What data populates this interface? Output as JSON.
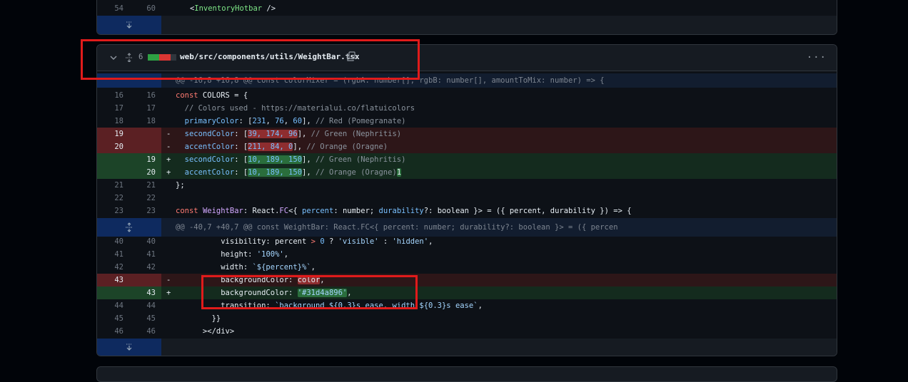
{
  "colors": {
    "red_box": "#e01b1b",
    "expander": "#0e2a5f",
    "deleted_row": "#2d1618",
    "added_row": "#142b1e"
  },
  "top_section": {
    "line": {
      "old": "54",
      "new": "60",
      "prefix": "<",
      "tag": "InventoryHotbar",
      "suffix": " />"
    }
  },
  "file_header": {
    "changes_count": "6",
    "diffstat_blocks": [
      "green",
      "green",
      "red",
      "red",
      "gray"
    ],
    "path": "web/src/components/utils/WeightBar.tsx",
    "icons": [
      "chevron-down-icon",
      "expand-lines-icon",
      "copy-icon",
      "more-options-icon"
    ]
  },
  "hunk1": "@@ -16,8 +16,8 @@ const colorMixer = (rgbA: number[], rgbB: number[], amountToMix: number) => {",
  "hunk2": "@@ -40,7 +40,7 @@ const WeightBar: React.FC<{ percent: number; durability?: boolean }> = ({ percen",
  "lines": {
    "l16": {
      "old": "16",
      "new": "16",
      "a": "const",
      "b": " COLORS = {"
    },
    "l17": {
      "old": "17",
      "new": "17",
      "text": "  // Colors used - https://materialui.co/flatuicolors"
    },
    "l18": {
      "old": "18",
      "new": "18",
      "key": "  primaryColor",
      "p1": ": [",
      "n1": "231",
      "c1": ", ",
      "n2": "76",
      "c2": ", ",
      "n3": "60",
      "end": "], ",
      "comment": "// Red (Pomegranate)"
    },
    "d19": {
      "old": "19",
      "sign": "-",
      "key": "  secondColor",
      "p1": ": [",
      "hl": "39, 174, 96",
      "end": "], ",
      "comment": "// Green (Nephritis)"
    },
    "d20": {
      "old": "20",
      "sign": "-",
      "key": "  accentColor",
      "p1": ": [",
      "hl": "211, 84, 0",
      "end": "], ",
      "comment": "// Orange (Oragne)"
    },
    "a19": {
      "new": "19",
      "sign": "+",
      "key": "  secondColor",
      "p1": ": [",
      "hl": "10, 189, 150",
      "end": "], ",
      "comment": "// Green (Nephritis)"
    },
    "a20": {
      "new": "20",
      "sign": "+",
      "key": "  accentColor",
      "p1": ": [",
      "hl": "10, 189, 150",
      "end": "], ",
      "comment": "// Orange (Oragne)",
      "extra": "1"
    },
    "l21": {
      "old": "21",
      "new": "21",
      "text": "};"
    },
    "l22": {
      "old": "22",
      "new": "22",
      "text": ""
    },
    "l23": {
      "old": "23",
      "new": "23",
      "a": "const",
      "b": " ",
      "fn": "WeightBar",
      "c": ": React.",
      "fc": "FC",
      "d": "<{ ",
      "p": "percent",
      "e": ": number; ",
      "du": "durability",
      "f": "?: boolean }> = ({ percent, durability }) => {"
    },
    "l40": {
      "old": "40",
      "new": "40",
      "a": "          visibility: percent ",
      "op": ">",
      "b": " ",
      "n": "0",
      "c": " ? ",
      "s1": "'visible'",
      "d": " : ",
      "s2": "'hidden'",
      "e": ","
    },
    "l41": {
      "old": "41",
      "new": "41",
      "a": "          height: ",
      "s": "'100%'",
      "e": ","
    },
    "l42": {
      "old": "42",
      "new": "42",
      "a": "          width: ",
      "s": "`${percent}%`",
      "e": ","
    },
    "d43": {
      "old": "43",
      "sign": "-",
      "a": "          backgroundColor: ",
      "hl": "color",
      "e": ","
    },
    "a43": {
      "new": "43",
      "sign": "+",
      "a": "          backgroundColor: ",
      "hl": "'#31d4a896'",
      "e": ","
    },
    "l44": {
      "old": "44",
      "new": "44",
      "a": "          transition: ",
      "s": "`background ${0.3}s ease, width ${0.3}s ease`",
      "e": ","
    },
    "l45": {
      "old": "45",
      "new": "45",
      "text": "        }}"
    },
    "l46": {
      "old": "46",
      "new": "46",
      "a": "      >",
      "b": "</div>"
    }
  }
}
